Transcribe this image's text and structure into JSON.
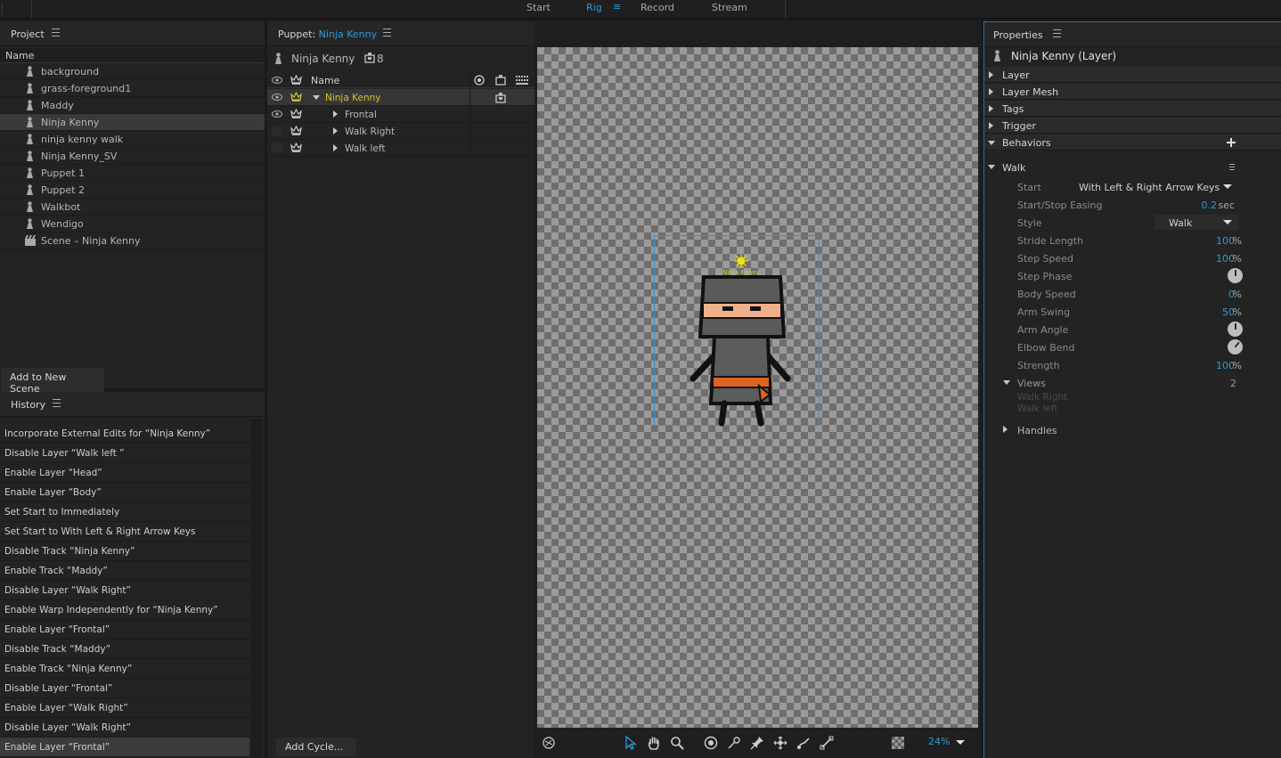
{
  "modes": [
    "Start",
    "Rig",
    "Record",
    "Stream"
  ],
  "active_mode": "Rig",
  "project": {
    "title": "Project",
    "column": "Name",
    "items": [
      {
        "label": "background",
        "type": "puppet"
      },
      {
        "label": "grass-foreground1",
        "type": "puppet"
      },
      {
        "label": "Maddy",
        "type": "puppet"
      },
      {
        "label": "Ninja Kenny",
        "type": "puppet",
        "selected": true
      },
      {
        "label": "ninja kenny walk",
        "type": "puppet"
      },
      {
        "label": "Ninja Kenny_SV",
        "type": "puppet"
      },
      {
        "label": "Puppet 1",
        "type": "puppet"
      },
      {
        "label": "Puppet 2",
        "type": "puppet"
      },
      {
        "label": "Walkbot",
        "type": "puppet"
      },
      {
        "label": "Wendigo",
        "type": "puppet"
      },
      {
        "label": "Scene – Ninja Kenny",
        "type": "scene"
      }
    ],
    "add_button": "Add to New Scene"
  },
  "history": {
    "title": "History",
    "items": [
      "Incorporate External Edits for “Ninja Kenny”",
      "Disable Layer “Walk left ”",
      "Enable Layer “Head”",
      "Enable Layer “Body”",
      "Set Start to Immediately",
      "Set Start to With Left & Right Arrow Keys",
      "Disable Track “Ninja Kenny”",
      "Enable Track “Maddy”",
      "Disable Layer “Walk Right”",
      "Enable Warp Independently for “Ninja Kenny”",
      "Enable Layer “Frontal”",
      "Disable Track “Maddy”",
      "Enable Track “Ninja Kenny”",
      "Disable Layer “Frontal”",
      "Enable Layer “Walk Right”",
      "Disable Layer “Walk Right”",
      "Enable Layer “Frontal”"
    ]
  },
  "puppet": {
    "header_prefix": "Puppet:",
    "header_name": "Ninja Kenny",
    "name": "Ninja Kenny",
    "count": "8",
    "column": "Name",
    "layers": [
      {
        "label": "Ninja Kenny",
        "indent": 0,
        "expanded": true,
        "selected": true,
        "visible": true
      },
      {
        "label": "Frontal",
        "indent": 1,
        "expanded": false,
        "visible": true
      },
      {
        "label": "Walk Right",
        "indent": 1,
        "expanded": false,
        "visible": false
      },
      {
        "label": "Walk left",
        "indent": 1,
        "expanded": false,
        "visible": false
      }
    ],
    "add_cycle": "Add Cycle..."
  },
  "stage": {
    "character_tag": "Ninja Kenny",
    "zoom": "24%"
  },
  "properties": {
    "title": "Properties",
    "layer_title": "Ninja Kenny (Layer)",
    "sections": [
      "Layer",
      "Layer Mesh",
      "Tags",
      "Trigger",
      "Behaviors"
    ],
    "behavior": "Walk",
    "start_label": "Start",
    "start_value": "With Left & Right Arrow Keys",
    "easing_label": "Start/Stop Easing",
    "easing_value": "0.2",
    "easing_unit": "sec",
    "style_label": "Style",
    "style_value": "Walk",
    "stride_label": "Stride Length",
    "stride_value": "100",
    "step_speed_label": "Step Speed",
    "step_speed_value": "100",
    "step_phase_label": "Step Phase",
    "body_speed_label": "Body Speed",
    "body_speed_value": "0",
    "arm_swing_label": "Arm Swing",
    "arm_swing_value": "50",
    "arm_angle_label": "Arm Angle",
    "elbow_bend_label": "Elbow Bend",
    "strength_label": "Strength",
    "strength_value": "100",
    "pct": "%",
    "views_label": "Views",
    "views_count": "2",
    "views": [
      "Walk Right",
      "Walk left"
    ],
    "handles_label": "Handles"
  },
  "colors": {
    "accent": "#2e9bd6",
    "highlight": "#d4c431",
    "selection_box": "#3a8fd0"
  }
}
